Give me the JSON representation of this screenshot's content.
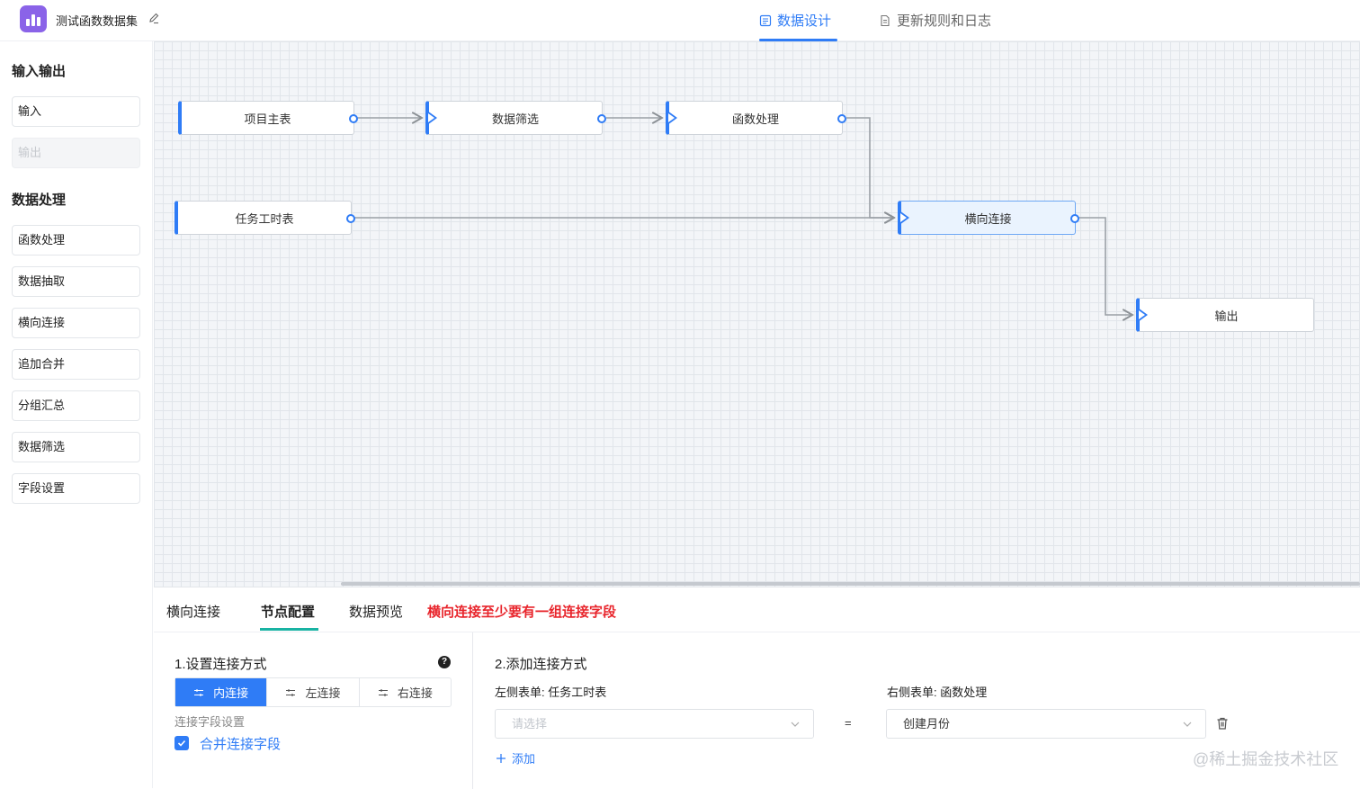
{
  "header": {
    "app_title": "测试函数数据集",
    "tabs": [
      {
        "label": "数据设计",
        "active": true,
        "icon": "design-icon"
      },
      {
        "label": "更新规则和日志",
        "active": false,
        "icon": "document-icon"
      }
    ]
  },
  "sidebar": {
    "sections": [
      {
        "title": "输入输出",
        "items": [
          {
            "label": "输入",
            "disabled": false
          },
          {
            "label": "输出",
            "disabled": true
          }
        ]
      },
      {
        "title": "数据处理",
        "items": [
          {
            "label": "函数处理"
          },
          {
            "label": "数据抽取"
          },
          {
            "label": "横向连接"
          },
          {
            "label": "追加合并"
          },
          {
            "label": "分组汇总"
          },
          {
            "label": "数据筛选"
          },
          {
            "label": "字段设置"
          }
        ]
      }
    ]
  },
  "canvas": {
    "nodes": [
      {
        "id": "n1",
        "label": "项目主表"
      },
      {
        "id": "n2",
        "label": "数据筛选"
      },
      {
        "id": "n3",
        "label": "函数处理"
      },
      {
        "id": "n4",
        "label": "任务工时表"
      },
      {
        "id": "n5",
        "label": "横向连接",
        "selected": true
      },
      {
        "id": "n6",
        "label": "输出"
      }
    ]
  },
  "bottom_panel": {
    "tabs": [
      {
        "label": "横向连接"
      },
      {
        "label": "节点配置",
        "active": true
      },
      {
        "label": "数据预览"
      }
    ],
    "warning": "横向连接至少要有一组连接字段",
    "join_method": {
      "title": "1.设置连接方式",
      "options": [
        {
          "label": "内连接",
          "active": true
        },
        {
          "label": "左连接",
          "active": false
        },
        {
          "label": "右连接",
          "active": false
        }
      ],
      "field_settings_label": "连接字段设置",
      "merge_checkbox": {
        "label": "合并连接字段",
        "checked": true
      }
    },
    "add_join": {
      "title": "2.添加连接方式",
      "left_label": "左侧表单:  任务工时表",
      "right_label": "右侧表单:  函数处理",
      "left_select_placeholder": "请选择",
      "right_select_value": "创建月份",
      "equals": "=",
      "add_label": "添加"
    },
    "watermark": "@稀土掘金技术社区"
  },
  "colors": {
    "accent": "#2f7cf6",
    "warning": "#e8242b",
    "tab_indicator": "#19b3a3",
    "logo": "#8a63e8"
  }
}
